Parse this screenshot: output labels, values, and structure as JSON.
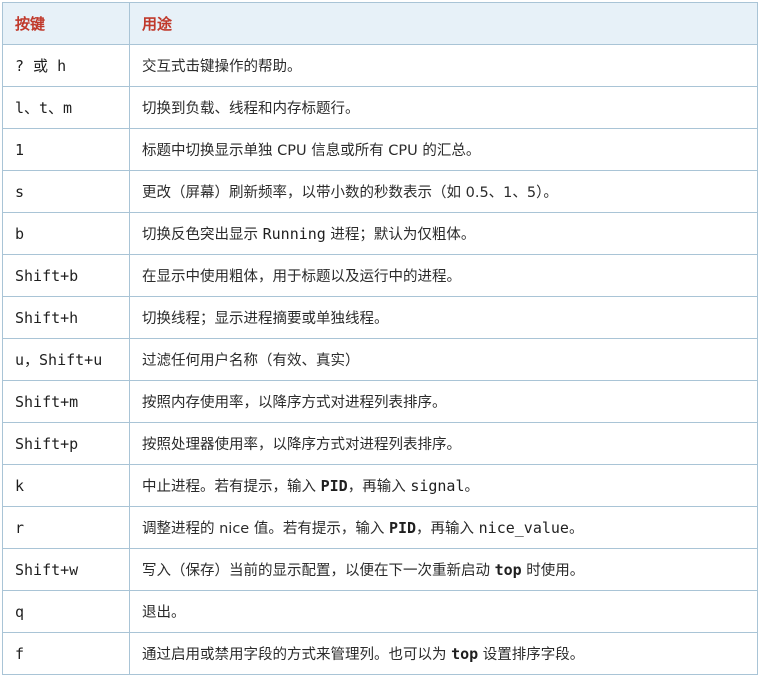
{
  "header": {
    "key_col": "按键",
    "desc_col": "用途"
  },
  "rows": [
    {
      "key": "? 或 h",
      "desc": [
        {
          "t": "交互式击键操作的帮助。"
        }
      ]
    },
    {
      "key": "l、t、m",
      "desc": [
        {
          "t": "切换到负载、线程和内存标题行。"
        }
      ]
    },
    {
      "key": "1",
      "desc": [
        {
          "t": "标题中切换显示单独 CPU 信息或所有 CPU 的汇总。"
        }
      ]
    },
    {
      "key": "s",
      "desc": [
        {
          "t": "更改（屏幕）刷新频率，以带小数的秒数表示（如 0.5、1、5）。"
        }
      ]
    },
    {
      "key": "b",
      "desc": [
        {
          "t": "切换反色突出显示 "
        },
        {
          "t": "Running",
          "s": "mono"
        },
        {
          "t": " 进程；默认为仅粗体。"
        }
      ]
    },
    {
      "key": "Shift+b",
      "desc": [
        {
          "t": "在显示中使用粗体，用于标题以及运行中的进程。"
        }
      ]
    },
    {
      "key": "Shift+h",
      "desc": [
        {
          "t": "切换线程；显示进程摘要或单独线程。"
        }
      ]
    },
    {
      "key": "u，Shift+u",
      "desc": [
        {
          "t": "过滤任何用户名称（有效、真实）"
        }
      ]
    },
    {
      "key": "Shift+m",
      "desc": [
        {
          "t": "按照内存使用率，以降序方式对进程列表排序。"
        }
      ]
    },
    {
      "key": "Shift+p",
      "desc": [
        {
          "t": "按照处理器使用率，以降序方式对进程列表排序。"
        }
      ]
    },
    {
      "key": "k",
      "desc": [
        {
          "t": "中止进程。若有提示，输入 "
        },
        {
          "t": "PID",
          "s": "mono-bold"
        },
        {
          "t": "，再输入 "
        },
        {
          "t": "signal",
          "s": "mono"
        },
        {
          "t": "。"
        }
      ]
    },
    {
      "key": "r",
      "desc": [
        {
          "t": "调整进程的 nice 值。若有提示，输入 "
        },
        {
          "t": "PID",
          "s": "mono-bold"
        },
        {
          "t": "，再输入 "
        },
        {
          "t": "nice_value",
          "s": "mono"
        },
        {
          "t": "。"
        }
      ]
    },
    {
      "key": "Shift+w",
      "desc": [
        {
          "t": "写入（保存）当前的显示配置，以便在下一次重新启动 "
        },
        {
          "t": "top",
          "s": "mono-bold"
        },
        {
          "t": " 时使用。"
        }
      ]
    },
    {
      "key": "q",
      "desc": [
        {
          "t": "退出。"
        }
      ]
    },
    {
      "key": "f",
      "desc": [
        {
          "t": "通过启用或禁用字段的方式来管理列。也可以为 "
        },
        {
          "t": "top",
          "s": "mono-bold"
        },
        {
          "t": " 设置排序字段。"
        }
      ]
    }
  ]
}
